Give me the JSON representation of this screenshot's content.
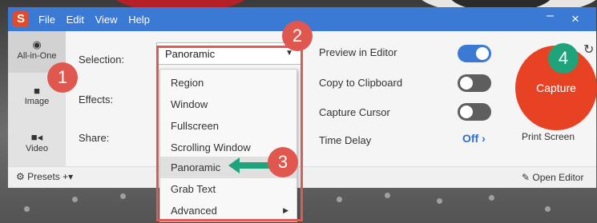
{
  "titlebar": {
    "menu": [
      "File",
      "Edit",
      "View",
      "Help"
    ],
    "minimize": "–",
    "close": "×"
  },
  "tabs": [
    {
      "label": "All-in-One",
      "icon": "record-icon"
    },
    {
      "label": "Image",
      "icon": "camera-icon"
    },
    {
      "label": "Video",
      "icon": "video-camera-icon"
    }
  ],
  "settings": {
    "selection_label": "Selection:",
    "selection_value": "Panoramic",
    "effects_label": "Effects:",
    "share_label": "Share:"
  },
  "dropdown": {
    "items": [
      "Region",
      "Window",
      "Fullscreen",
      "Scrolling Window",
      "Panoramic",
      "Grab Text",
      "Advanced"
    ],
    "highlighted": "Panoramic"
  },
  "options": {
    "preview_in_editor": {
      "label": "Preview in Editor",
      "state": "on"
    },
    "copy_to_clipboard": {
      "label": "Copy to Clipboard",
      "state": "off"
    },
    "capture_cursor": {
      "label": "Capture Cursor",
      "state": "off"
    },
    "time_delay": {
      "label": "Time Delay",
      "value": "Off ›"
    }
  },
  "capture": {
    "button_label": "Capture",
    "shortcut_label": "Print Screen"
  },
  "bottombar": {
    "presets_label": "Presets",
    "add_label": "+▾",
    "open_editor_label": "Open Editor"
  },
  "callouts": [
    "1",
    "2",
    "3",
    "4"
  ],
  "colors": {
    "titlebar": "#3a7ad5",
    "capture_button": "#e84224",
    "toggle_on": "#3a7ad5",
    "callout_red": "#e0574f",
    "callout_green": "#1ea37a"
  }
}
